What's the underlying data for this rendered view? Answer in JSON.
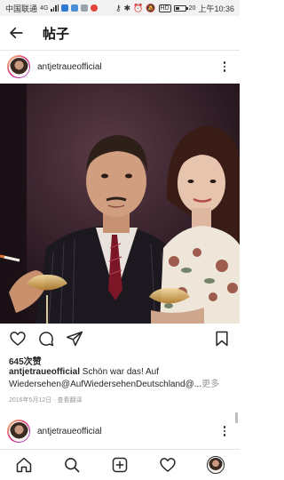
{
  "status_bar": {
    "carrier": "中国联通",
    "network": "4G",
    "battery": "20",
    "time": "上午10:36"
  },
  "header": {
    "title": "帖子"
  },
  "post": {
    "username": "antjetraueofficial",
    "likes": "645次赞",
    "caption_user": "antjetraueofficial",
    "caption_text": " Schön war das! Auf Wiedersehen@AufWiedersehenDeutschland@...",
    "caption_more": "更多",
    "date": "2016年5月12日",
    "translate": " · 查看翻译"
  },
  "next_post": {
    "username": "antjetraueofficial"
  },
  "icons": {
    "back": "arrow-left-icon",
    "more": "more-vertical-icon",
    "like": "heart-icon",
    "comment": "comment-icon",
    "share": "send-icon",
    "save": "bookmark-icon",
    "home": "home-icon",
    "search": "search-icon",
    "new_post": "plus-square-icon",
    "activity": "heart-icon",
    "profile": "profile-avatar-icon"
  }
}
